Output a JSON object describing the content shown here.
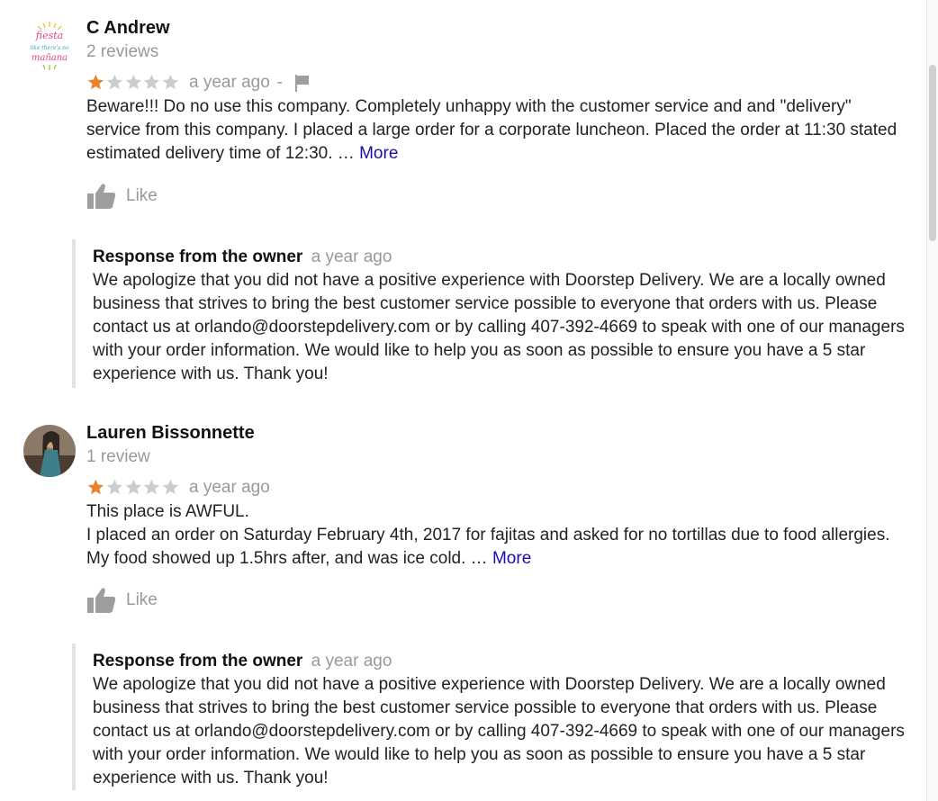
{
  "reviews": [
    {
      "reviewer": "C Andrew",
      "review_count": "2 reviews",
      "rating": 1,
      "max_rating": 5,
      "time": "a year ago",
      "separator": "-",
      "text": "Beware!!! Do no use this company. Completely unhappy with the customer service and and \"delivery\" service from this company. I placed a large order for a corporate luncheon. Placed the order at 11:30 stated estimated delivery time of 12:30. …",
      "more_label": "More",
      "like_label": "Like",
      "response": {
        "title": "Response from the owner",
        "time": "a year ago",
        "text": "We apologize that you did not have a positive experience with Doorstep Delivery. We are a locally owned business that strives to bring the best customer service possible to everyone that orders with us. Please contact us at orlando@doorstepdelivery.com or by calling 407-392-4669 to speak with one of our managers with your order information. We would like to help you as soon as possible to ensure you have a 5 star experience with us. Thank you!"
      }
    },
    {
      "reviewer": "Lauren Bissonnette",
      "review_count": "1 review",
      "rating": 1,
      "max_rating": 5,
      "time": "a year ago",
      "text_line1": "This place is AWFUL.",
      "text": "I placed an order on Saturday February 4th, 2017 for fajitas and asked for no tortillas due to food allergies. My food showed up 1.5hrs after, and was ice cold. …",
      "more_label": "More",
      "like_label": "Like",
      "response": {
        "title": "Response from the owner",
        "time": "a year ago",
        "text": "We apologize that you did not have a positive experience with Doorstep Delivery. We are a locally owned business that strives to bring the best customer service possible to everyone that orders with us. Please contact us at orlando@doorstepdelivery.com or by calling 407-392-4669 to speak with one of our managers with your order information. We would like to help you as soon as possible to ensure you have a 5 star experience with us. Thank you!"
      }
    }
  ],
  "logo_text": [
    "fiesta",
    "like there's no",
    "mañana"
  ],
  "colors": {
    "star_filled": "#e8822b",
    "star_empty": "#cccccc",
    "link": "#1a0dab",
    "muted": "#999999"
  },
  "icons": {
    "like": "thumbs-up-icon",
    "flag": "flag-icon",
    "star": "star-icon"
  }
}
